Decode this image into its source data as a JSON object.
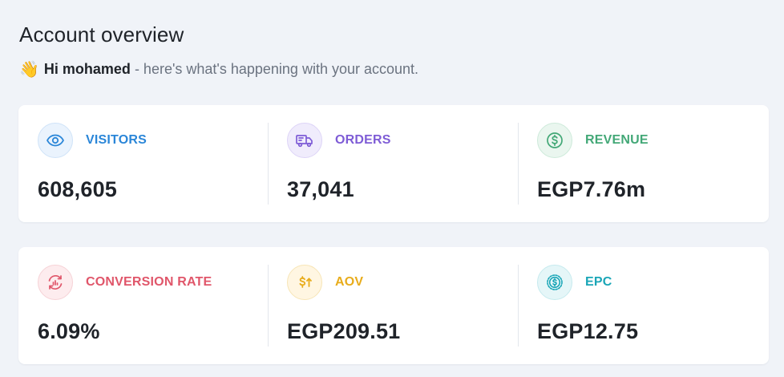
{
  "header": {
    "title": "Account overview",
    "greeting_emoji": "👋",
    "greeting_name": "Hi mohamed",
    "greeting_rest": "- here's what's happening with your account."
  },
  "colors": {
    "background": "#f0f3f8",
    "visitors": "#2a86d8",
    "orders": "#7e5cd6",
    "revenue": "#43a877",
    "conversion_rate": "#e0566a",
    "aov": "#e8ac1b",
    "epc": "#1aa6b7"
  },
  "stats": [
    {
      "label": "VISITORS",
      "value": "608,605",
      "icon": "eye-icon"
    },
    {
      "label": "ORDERS",
      "value": "37,041",
      "icon": "truck-icon"
    },
    {
      "label": "REVENUE",
      "value": "EGP7.76m",
      "icon": "dollar-circle-icon"
    },
    {
      "label": "CONVERSION RATE",
      "value": "6.09%",
      "icon": "conversion-chart-icon"
    },
    {
      "label": "AOV",
      "value": "EGP209.51",
      "icon": "dollar-up-arrow-icon"
    },
    {
      "label": "EPC",
      "value": "EGP12.75",
      "icon": "dollar-badge-icon"
    }
  ]
}
